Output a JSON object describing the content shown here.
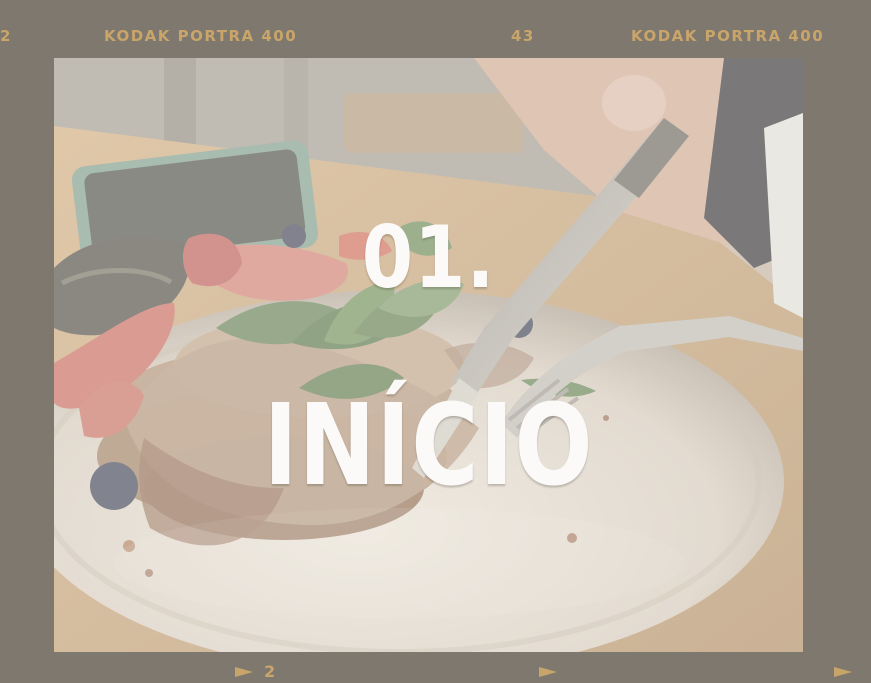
{
  "film_strip": {
    "top_left_number": "2",
    "top_left_label": "KODAK PORTRA 400",
    "top_center_number": "43",
    "top_right_label": "KODAK PORTRA 400",
    "bottom_number": "2"
  },
  "photo": {
    "scene": "pancakes-with-fruit-and-mint"
  },
  "title": {
    "number": "01.",
    "heading": "INÍCIO"
  },
  "colors": {
    "frame": "#7f786f",
    "film_text": "#c9a56a",
    "title": "#fbfaf8"
  }
}
